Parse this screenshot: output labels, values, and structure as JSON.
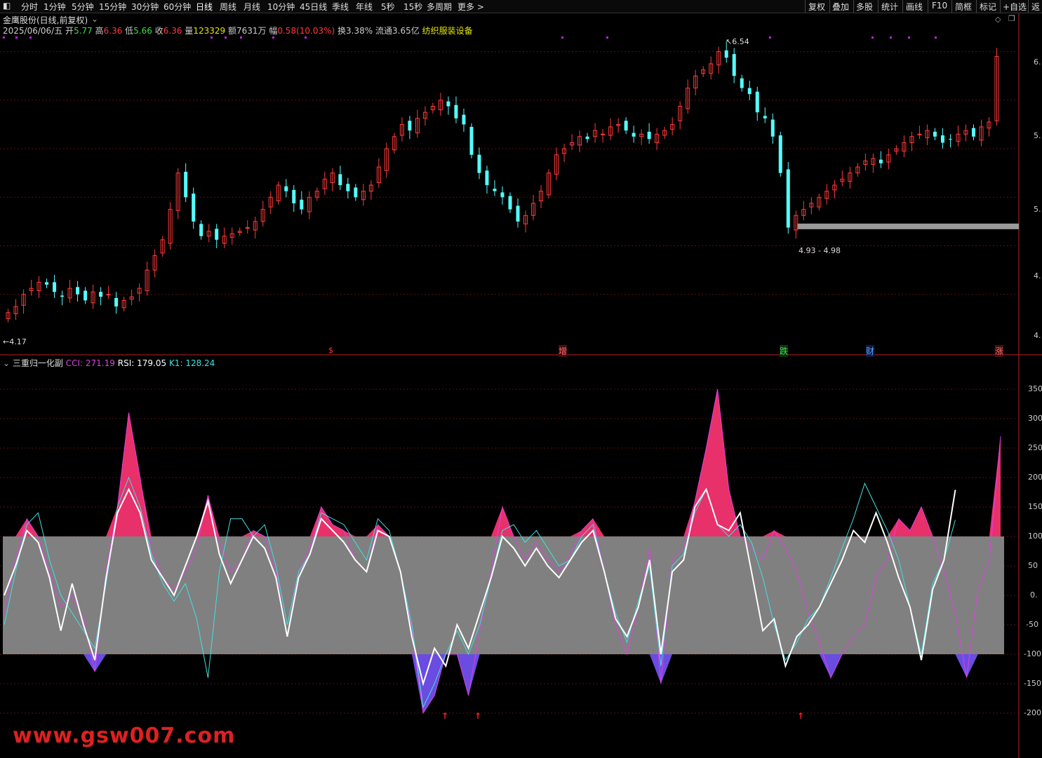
{
  "toolbar": {
    "periods": [
      "分时",
      "1分钟",
      "5分钟",
      "15分钟",
      "30分钟",
      "60分钟",
      "日线",
      "周线",
      "月线",
      "10分钟",
      "45日线",
      "季线",
      "年线",
      "5秒",
      "15秒",
      "多周期",
      "更多 >"
    ],
    "active_period": "日线",
    "right_buttons": [
      "复权",
      "叠加",
      "多股",
      "统计",
      "画线",
      "F10",
      "简框",
      "标记",
      "+自选",
      "返"
    ]
  },
  "stock": {
    "title": "金鹰股份(日线,前复权)",
    "date": "2025/06/06/五",
    "open_label": "开",
    "open": "5.77",
    "high_label": "高",
    "high": "6.36",
    "low_label": "低",
    "low": "5.66",
    "close_label": "收",
    "close": "6.36",
    "volume_label": "量",
    "volume": "123329",
    "amount_label": "额",
    "amount": "7631万",
    "range_label": "幅",
    "range": "0.58(10.03%)",
    "turnover_label": "换",
    "turnover": "3.38%",
    "float_label": "流通",
    "float": "3.65亿",
    "sector": "纺织服装设备"
  },
  "annotations": {
    "high_mark": "6.54",
    "low_mark": "4.17",
    "zone_label": "4.93 - 4.98",
    "events": [
      "$",
      "增",
      "跌",
      "财",
      "涨"
    ]
  },
  "price_axis": [
    "6.",
    "5.",
    "5.",
    "4.",
    "4."
  ],
  "indicator": {
    "name": "三重归一化副",
    "cci_label": "CCI:",
    "cci_value": "271.19",
    "rsi_label": "RSI:",
    "rsi_value": "179.05",
    "k1_label": "K1:",
    "k1_value": "128.24",
    "axis": [
      "350",
      "300",
      "250",
      "200",
      "150",
      "100",
      "50",
      "0.",
      "-50",
      "-100",
      "-150",
      "-200"
    ]
  },
  "watermark": "www.gsw007.com",
  "colors": {
    "up": "#ff3b3b",
    "down": "#54ffff",
    "cci": "#e040e0",
    "rsi": "#ffffff",
    "k1": "#40e0e0",
    "fill_high": "#e8306a",
    "fill_low": "#6a4ce0",
    "band": "#808080"
  },
  "chart_data": [
    {
      "type": "candlestick",
      "title": "金鹰股份(日线,前复权)",
      "ylabel": "",
      "ylim": [
        4.0,
        6.6
      ],
      "high": 6.54,
      "low": 4.17,
      "last_close": 6.36,
      "close": [
        4.25,
        4.3,
        4.4,
        4.45,
        4.5,
        4.48,
        4.42,
        4.38,
        4.45,
        4.4,
        4.35,
        4.42,
        4.38,
        4.4,
        4.3,
        4.35,
        4.38,
        4.45,
        4.6,
        4.72,
        4.85,
        5.1,
        5.4,
        5.2,
        5.0,
        4.88,
        4.92,
        4.85,
        4.88,
        4.9,
        4.92,
        4.95,
        5.0,
        5.1,
        5.2,
        5.3,
        5.25,
        5.15,
        5.1,
        5.2,
        5.25,
        5.35,
        5.4,
        5.3,
        5.25,
        5.2,
        5.25,
        5.3,
        5.45,
        5.6,
        5.7,
        5.8,
        5.75,
        5.85,
        5.9,
        5.95,
        6.0,
        5.95,
        5.85,
        5.8,
        5.55,
        5.4,
        5.3,
        5.25,
        5.2,
        5.1,
        5.0,
        5.05,
        5.15,
        5.25,
        5.4,
        5.55,
        5.6,
        5.65,
        5.7,
        5.68,
        5.75,
        5.72,
        5.78,
        5.8,
        5.75,
        5.7,
        5.72,
        5.68,
        5.72,
        5.75,
        5.8,
        5.95,
        6.1,
        6.2,
        6.25,
        6.3,
        6.4,
        6.35,
        6.2,
        6.1,
        6.05,
        5.9,
        5.85,
        5.7,
        5.4,
        4.95,
        5.05,
        5.1,
        5.15,
        5.2,
        5.25,
        5.3,
        5.35,
        5.4,
        5.45,
        5.5,
        5.52,
        5.48,
        5.55,
        5.6,
        5.65,
        5.7,
        5.72,
        5.75,
        5.7,
        5.65,
        5.68,
        5.72,
        5.75,
        5.7,
        5.78,
        5.82,
        6.36
      ]
    },
    {
      "type": "line",
      "title": "三重归一化副",
      "ylim": [
        -250,
        380
      ],
      "band": [
        -100,
        100
      ],
      "series": [
        {
          "name": "CCI",
          "values": [
            -30,
            60,
            130,
            100,
            40,
            -20,
            0,
            -40,
            -130,
            40,
            150,
            310,
            200,
            80,
            30,
            10,
            40,
            80,
            170,
            90,
            40,
            60,
            110,
            100,
            40,
            -70,
            40,
            80,
            150,
            120,
            110,
            60,
            40,
            120,
            100,
            40,
            -60,
            -200,
            -170,
            -100,
            -100,
            -170,
            -60,
            40,
            150,
            100,
            60,
            90,
            60,
            40,
            70,
            110,
            130,
            40,
            -50,
            -100,
            -20,
            80,
            -150,
            60,
            80,
            160,
            250,
            350,
            180,
            100,
            80,
            60,
            110,
            80,
            40,
            -30,
            -80,
            -140,
            -100,
            -70,
            -50,
            30,
            60,
            130,
            110,
            150,
            100,
            40,
            -30,
            -140,
            10,
            60,
            270
          ]
        },
        {
          "name": "RSI",
          "values": [
            0,
            50,
            110,
            90,
            30,
            -60,
            20,
            -50,
            -110,
            30,
            140,
            180,
            140,
            60,
            30,
            0,
            50,
            100,
            160,
            70,
            20,
            60,
            100,
            80,
            30,
            -70,
            30,
            70,
            130,
            110,
            90,
            60,
            40,
            110,
            100,
            40,
            -70,
            -150,
            -90,
            -120,
            -50,
            -90,
            -30,
            30,
            100,
            80,
            50,
            80,
            50,
            30,
            60,
            90,
            110,
            40,
            -40,
            -70,
            -20,
            60,
            -100,
            40,
            60,
            150,
            180,
            120,
            110,
            140,
            40,
            -60,
            -40,
            -120,
            -70,
            -50,
            -20,
            20,
            60,
            110,
            90,
            140,
            90,
            30,
            -20,
            -110,
            10,
            60,
            179
          ]
        },
        {
          "name": "K1",
          "values": [
            -50,
            40,
            120,
            140,
            60,
            0,
            -30,
            -60,
            -90,
            20,
            150,
            200,
            150,
            70,
            20,
            -10,
            20,
            -40,
            -140,
            40,
            130,
            130,
            100,
            120,
            50,
            -50,
            40,
            70,
            140,
            130,
            120,
            90,
            60,
            130,
            110,
            40,
            -50,
            -190,
            -150,
            -100,
            -60,
            -100,
            -50,
            30,
            110,
            120,
            90,
            110,
            80,
            50,
            60,
            100,
            120,
            40,
            -30,
            -80,
            -10,
            50,
            -120,
            50,
            70,
            140,
            180,
            120,
            100,
            120,
            90,
            30,
            -50,
            -110,
            -80,
            -40,
            -20,
            30,
            80,
            130,
            190,
            150,
            110,
            60,
            -20,
            -100,
            20,
            60,
            128
          ]
        }
      ]
    }
  ]
}
